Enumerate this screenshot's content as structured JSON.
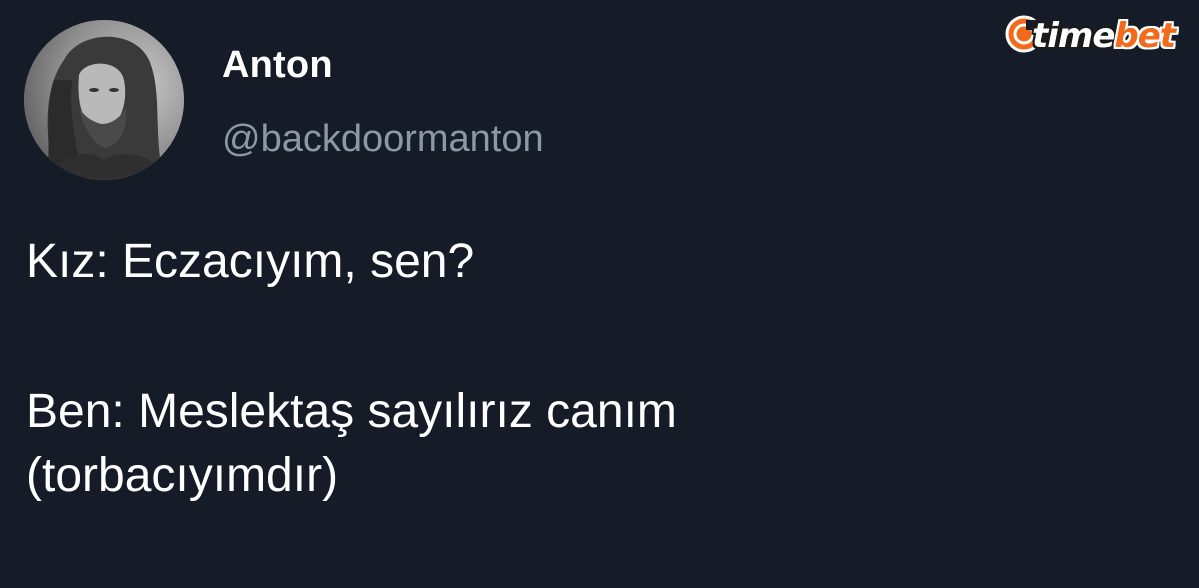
{
  "tweet": {
    "author": {
      "display_name": "Anton",
      "handle": "@backdoormanton",
      "avatar": "profile-photo-icon"
    },
    "text_lines": {
      "line1": "Kız: Eczacıyım, sen?",
      "line2": "Ben: Meslektaş sayılırız canım",
      "line3": "(torbacıyımdır)"
    }
  },
  "watermark": {
    "brand_part1": "time",
    "brand_part2": "bet",
    "icon": "clock-icon",
    "accent_color": "#f26a1b"
  },
  "colors": {
    "background": "#161b28",
    "primary_text": "#ffffff",
    "secondary_text": "#8b98a5"
  }
}
